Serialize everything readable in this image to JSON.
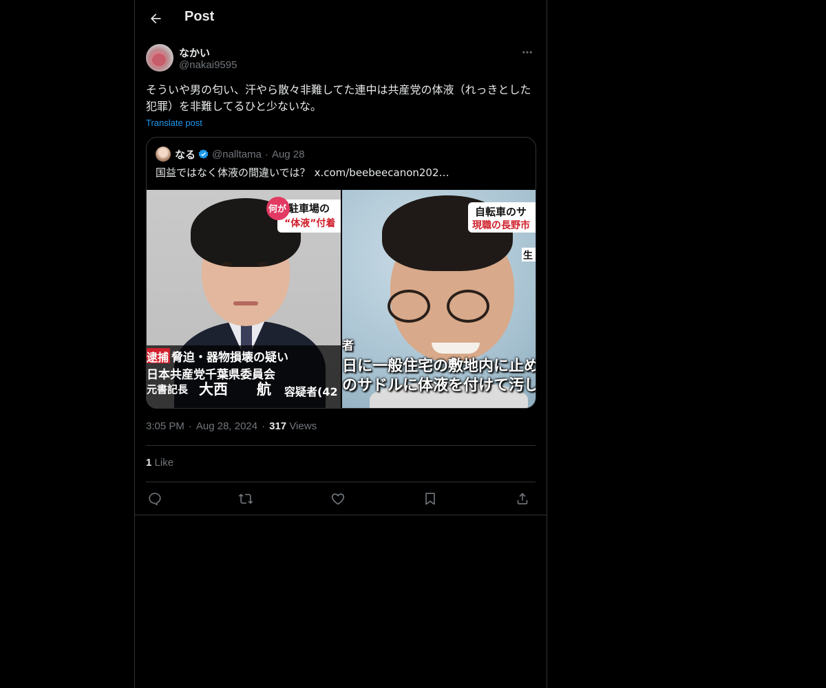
{
  "header": {
    "title": "Post"
  },
  "post": {
    "author": {
      "name": "なかい",
      "handle": "@nakai9595"
    },
    "text": "そういや男の匂い、汗やら散々非難してた連中は共産党の体液（れっきとした犯罪）を非難してるひと少ないな。",
    "translate_label": "Translate post",
    "time": "3:05 PM",
    "date": "Aug 28, 2024",
    "views_count": "317",
    "views_label": "Views",
    "likes_count": "1",
    "likes_label": "Like"
  },
  "quote": {
    "name": "なる",
    "handle": "@nalltama",
    "date": "Aug 28",
    "text": "国益ではなく体液の間違いでは？",
    "link": "x.com/beebeecanon202…",
    "images": {
      "left": {
        "tag": "何が",
        "headline": "駐車場の",
        "subline": "“体液”付着",
        "label_red": "逮捕",
        "line1": "脅迫・器物損壊の疑い",
        "line2": "日本共産党千葉県委員会",
        "line3_role": "元書記長",
        "line3_name": "大西　　航",
        "line3_suffix": "容疑者(42"
      },
      "right": {
        "headline": "自転車のサ",
        "subline": "現職の長野市",
        "side": "生",
        "corner": "者",
        "line1": "日に一般住宅の敷地内に止めて",
        "line2": "のサドルに体液を付けて汚した"
      }
    }
  },
  "colors": {
    "accent": "#1d9bf0",
    "muted": "#71767b",
    "text": "#e7e9ea",
    "border": "#2f3336",
    "verified": "#1d9bf0"
  },
  "icons": [
    "back-arrow-icon",
    "more-icon",
    "verified-badge-icon",
    "reply-icon",
    "repost-icon",
    "like-icon",
    "bookmark-icon",
    "share-icon"
  ]
}
